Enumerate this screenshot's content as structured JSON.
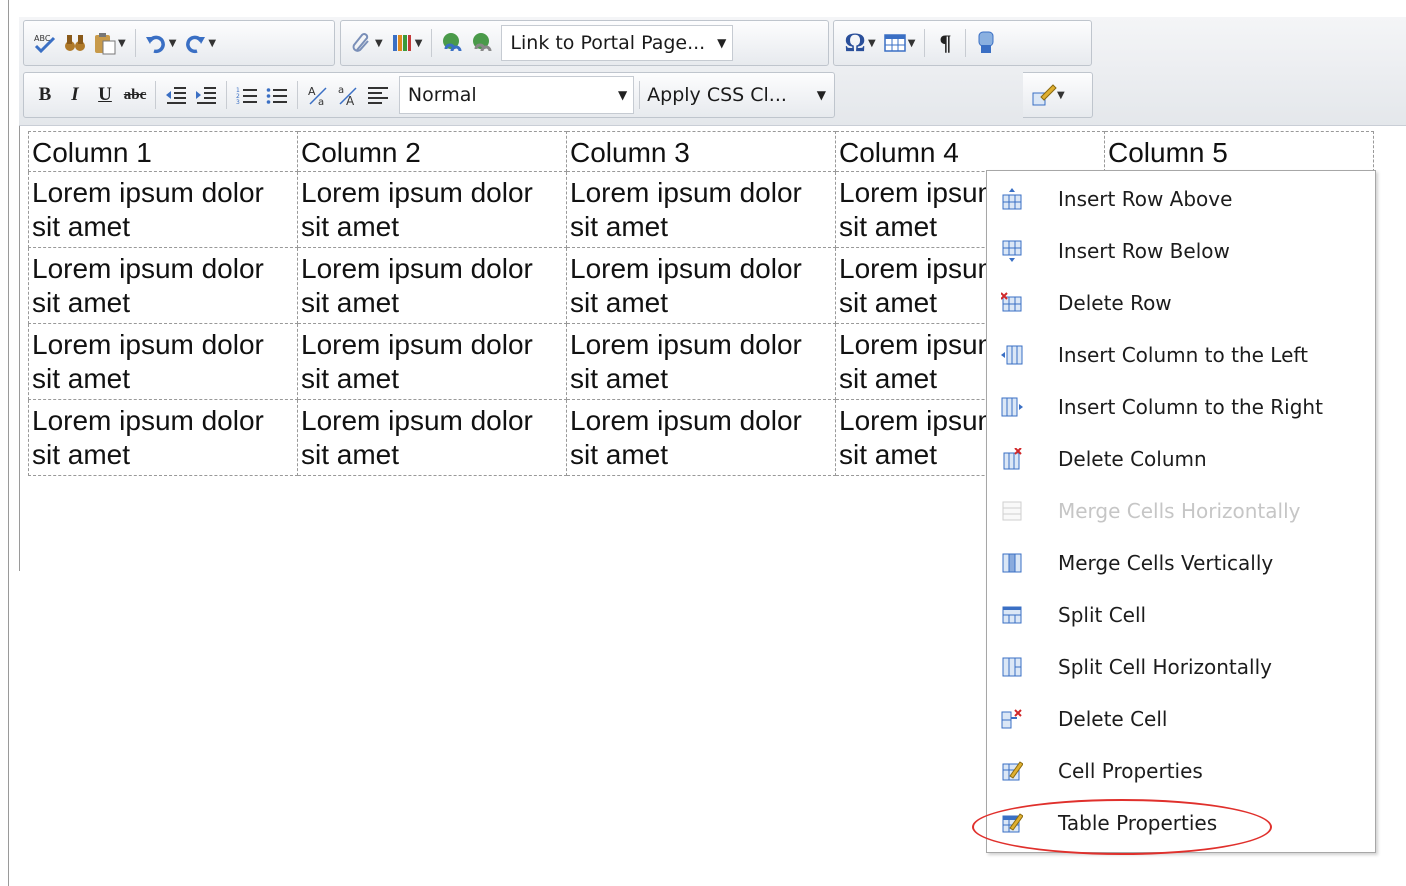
{
  "toolbar": {
    "row1": {
      "link_to_portal_page": "Link to Portal Page...",
      "omega": "Ω",
      "pilcrow": "¶"
    },
    "row2": {
      "bold": "B",
      "italic": "I",
      "underline": "U",
      "strike": "abc",
      "paragraph_style": "Normal",
      "apply_css_class": "Apply CSS Cl..."
    }
  },
  "table": {
    "headers": [
      "Column 1",
      "Column 2",
      "Column 3",
      "Column 4",
      "Column 5"
    ],
    "rows": [
      [
        "Lorem ipsum dolor sit amet",
        "Lorem ipsum dolor sit amet",
        "Lorem ipsum dolor sit amet",
        "Lorem ipsum dolor sit amet",
        ""
      ],
      [
        "Lorem ipsum dolor sit amet",
        "Lorem ipsum dolor sit amet",
        "Lorem ipsum dolor sit amet",
        "Lorem ipsum dolor sit amet",
        ""
      ],
      [
        "Lorem ipsum dolor sit amet",
        "Lorem ipsum dolor sit amet",
        "Lorem ipsum dolor sit amet",
        "Lorem ipsum dolor sit amet",
        ""
      ],
      [
        "Lorem ipsum dolor sit amet",
        "Lorem ipsum dolor sit amet",
        "Lorem ipsum dolor sit amet",
        "Lorem ipsum dolor sit amet",
        ""
      ]
    ]
  },
  "context_menu": {
    "items": [
      {
        "label": "Insert Row Above",
        "icon": "insert-row-above-icon",
        "enabled": true
      },
      {
        "label": "Insert Row Below",
        "icon": "insert-row-below-icon",
        "enabled": true
      },
      {
        "label": "Delete Row",
        "icon": "delete-row-icon",
        "enabled": true
      },
      {
        "label": "Insert Column to the Left",
        "icon": "insert-column-left-icon",
        "enabled": true
      },
      {
        "label": "Insert Column to the Right",
        "icon": "insert-column-right-icon",
        "enabled": true
      },
      {
        "label": "Delete Column",
        "icon": "delete-column-icon",
        "enabled": true
      },
      {
        "label": "Merge Cells Horizontally",
        "icon": "merge-cells-horizontally-icon",
        "enabled": false
      },
      {
        "label": "Merge Cells Vertically",
        "icon": "merge-cells-vertically-icon",
        "enabled": true
      },
      {
        "label": "Split Cell",
        "icon": "split-cell-icon",
        "enabled": true
      },
      {
        "label": "Split Cell Horizontally",
        "icon": "split-cell-horizontally-icon",
        "enabled": true
      },
      {
        "label": "Delete Cell",
        "icon": "delete-cell-icon",
        "enabled": true
      },
      {
        "label": "Cell Properties",
        "icon": "cell-properties-icon",
        "enabled": true
      },
      {
        "label": "Table Properties",
        "icon": "table-properties-icon",
        "enabled": true
      }
    ]
  },
  "colors": {
    "highlight_ring": "#e0302c",
    "icon_blue": "#3a6fc4"
  }
}
